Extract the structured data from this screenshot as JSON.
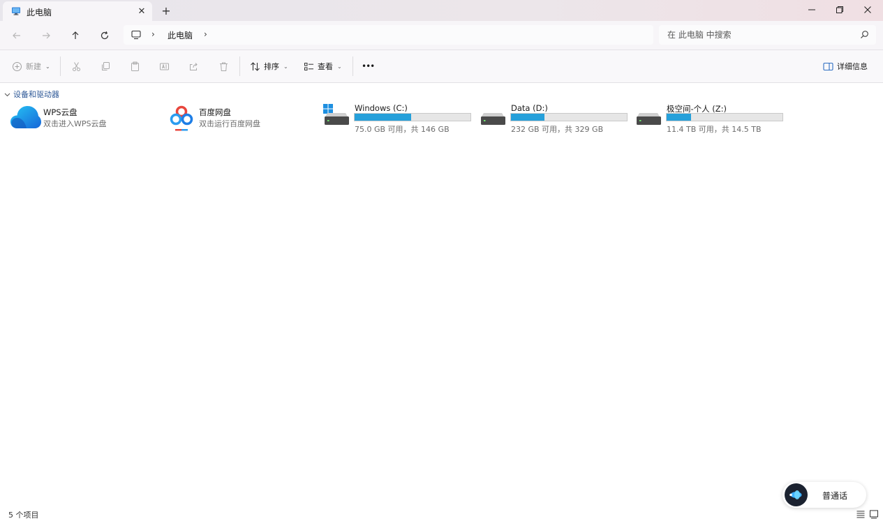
{
  "window": {
    "tab_title": "此电脑",
    "tab_close": "✕",
    "new_tab": "+",
    "controls": {
      "minimize": "minimize-icon",
      "maximize": "restore-icon",
      "close": "close-icon"
    }
  },
  "nav": {
    "buttons": [
      "back-icon",
      "forward-icon",
      "up-icon",
      "refresh-icon"
    ],
    "breadcrumb": {
      "location": "此电脑",
      "separator": "›"
    },
    "search_placeholder": "在 此电脑 中搜索"
  },
  "toolbar": {
    "new_label": "新建",
    "sort_label": "排序",
    "view_label": "查看",
    "more_label": "•••",
    "details_label": "详细信息",
    "dropdown_glyph": "⌄",
    "disabled_actions": [
      "cut-icon",
      "copy-icon",
      "paste-icon",
      "rename-icon",
      "share-icon",
      "delete-icon"
    ]
  },
  "group": {
    "header": "设备和驱动器",
    "items": [
      {
        "name": "WPS云盘",
        "subtitle": "双击进入WPS云盘",
        "icon": "cloud-icon"
      },
      {
        "name": "百度网盘",
        "subtitle": "双击运行百度网盘",
        "icon": "baidu-netdisk-icon"
      }
    ],
    "drives": [
      {
        "name": "Windows (C:)",
        "usage_text": "75.0 GB 可用，共 146 GB",
        "used_fraction": 0.49,
        "icon": "windows-drive-icon"
      },
      {
        "name": "Data (D:)",
        "usage_text": "232 GB 可用，共 329 GB",
        "used_fraction": 0.29,
        "icon": "drive-icon"
      },
      {
        "name": "极空间-个人 (Z:)",
        "usage_text": "11.4 TB 可用，共 14.5 TB",
        "used_fraction": 0.21,
        "icon": "network-drive-icon"
      }
    ]
  },
  "status": {
    "count_text": "5 个项目",
    "views": [
      "details-view-icon",
      "large-icons-view-icon"
    ]
  },
  "voice_widget": {
    "label": "普通话"
  },
  "colors": {
    "accent": "#26a0da",
    "group_header": "#2c5796"
  }
}
